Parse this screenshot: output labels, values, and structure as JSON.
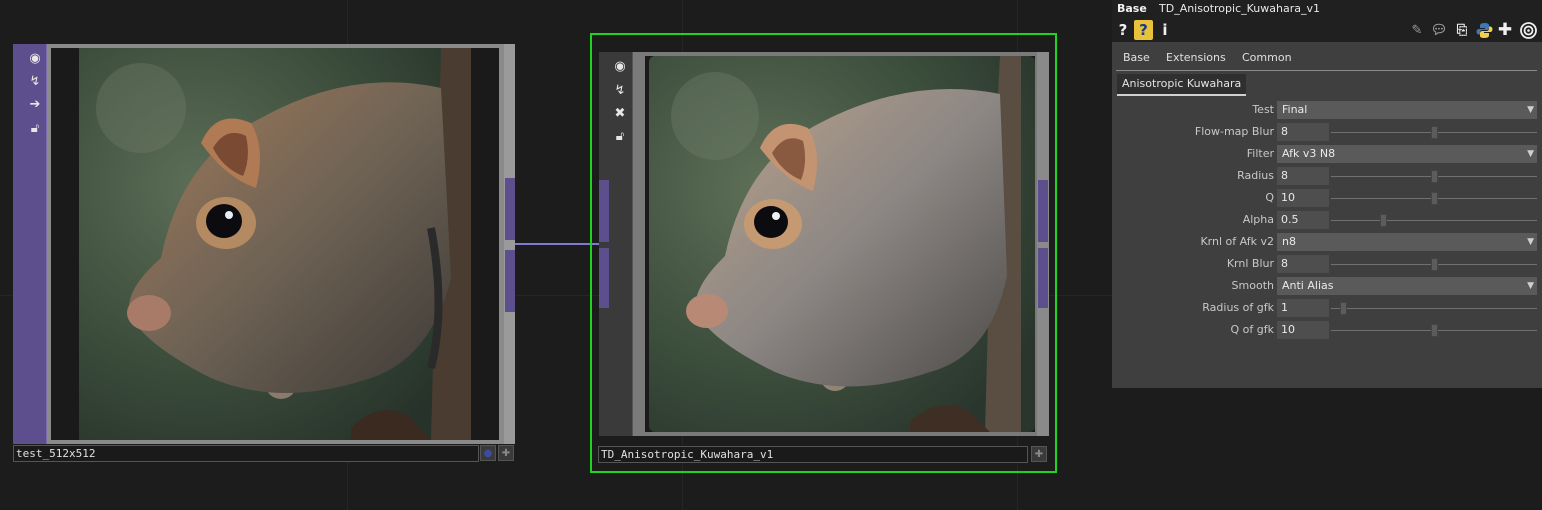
{
  "colors": {
    "background": "#1c1c1c",
    "node_purple": "#5d4f8e",
    "wire": "#7d7ad0",
    "selection_green": "#1fd41f",
    "panel_bg": "#3f3f3f"
  },
  "node_input": {
    "name": "test_512x512",
    "side_icons": [
      "viewer-icon",
      "bypass-icon",
      "arrow-right-icon",
      "lock-icon"
    ]
  },
  "node_output": {
    "name": "TD_Anisotropic_Kuwahara_v1",
    "side_icons": [
      "viewer-icon",
      "bypass-icon",
      "close-icon",
      "lock-icon"
    ]
  },
  "panel": {
    "type_label": "Base",
    "op_name": "TD_Anisotropic_Kuwahara_v1",
    "toolbar_left": [
      "help-icon",
      "op-help-icon",
      "info-icon"
    ],
    "toolbar_right": [
      "edit-icon",
      "comment-icon",
      "clone-icon",
      "python-icon",
      "add-icon",
      "target-icon"
    ],
    "tabs": [
      "Base",
      "Extensions",
      "Common"
    ],
    "active_page": "Anisotropic Kuwahara",
    "params": [
      {
        "label": "Test",
        "kind": "menu",
        "value": "Final"
      },
      {
        "label": "Flow-map Blur",
        "kind": "slider",
        "value": "8",
        "fraction": 0.5
      },
      {
        "label": "Filter",
        "kind": "menu",
        "value": "Afk v3 N8"
      },
      {
        "label": "Radius",
        "kind": "slider",
        "value": "8",
        "fraction": 0.5
      },
      {
        "label": "Q",
        "kind": "slider",
        "value": "10",
        "fraction": 0.5
      },
      {
        "label": "Alpha",
        "kind": "slider",
        "value": "0.5",
        "fraction": 0.25
      },
      {
        "label": "Krnl of Afk v2",
        "kind": "menu",
        "value": "n8"
      },
      {
        "label": "Krnl Blur",
        "kind": "slider",
        "value": "8",
        "fraction": 0.5
      },
      {
        "label": "Smooth",
        "kind": "menu",
        "value": "Anti Alias"
      },
      {
        "label": "Radius of gfk",
        "kind": "slider",
        "value": "1",
        "fraction": 0.06
      },
      {
        "label": "Q of gfk",
        "kind": "slider",
        "value": "10",
        "fraction": 0.5
      }
    ]
  }
}
